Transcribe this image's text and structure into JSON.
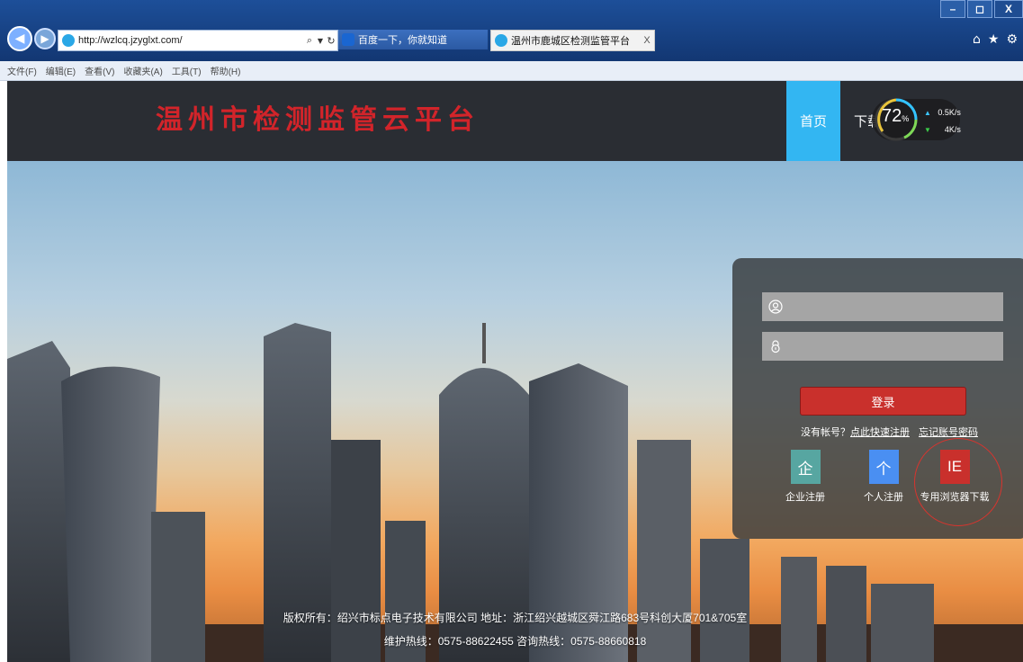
{
  "browser": {
    "url": "http://wzlcq.jzyglxt.com/",
    "tabs": [
      {
        "label": "百度一下，你就知道"
      },
      {
        "label": "温州市鹿城区检测监管平台",
        "close": "X"
      }
    ],
    "menu": [
      "文件(F)",
      "编辑(E)",
      "查看(V)",
      "收藏夹(A)",
      "工具(T)",
      "帮助(H)"
    ],
    "window_controls": {
      "minimize": "–",
      "restore": "◻",
      "close": "X"
    }
  },
  "site": {
    "title": "温州市检测监管云平台",
    "nav": {
      "home": "首页",
      "download": "下载"
    }
  },
  "speed_widget": {
    "value": "72",
    "unit": "%",
    "upload": "0.5K/s",
    "download": "4K/s",
    "ring_colors": [
      "#e9c43b",
      "#33c3ff",
      "#7ed957"
    ]
  },
  "login": {
    "username_value": "",
    "password_value": "",
    "login_label": "登录",
    "no_account_text": "没有帐号？",
    "register_link": "点此快速注册",
    "forgot_link": "忘记账号密码",
    "tiles": [
      {
        "glyph": "企",
        "label": "企业注册",
        "color": "#57a6a1"
      },
      {
        "glyph": "个",
        "label": "个人注册",
        "color": "#4a8ff2"
      },
      {
        "glyph": "IE",
        "label": "专用浏览器下载",
        "color": "#c9302c"
      }
    ]
  },
  "footer": {
    "line1": "版权所有：绍兴市标点电子技术有限公司 地址：浙江绍兴越城区舜江路683号科创大厦701&705室",
    "line2": "维护热线：0575-88622455 咨询热线：0575-88660818"
  },
  "colors": {
    "header_bg": "#2a2d33",
    "title_red": "#d2242a",
    "home_blue": "#33b6f2",
    "login_red": "#c9302c"
  }
}
